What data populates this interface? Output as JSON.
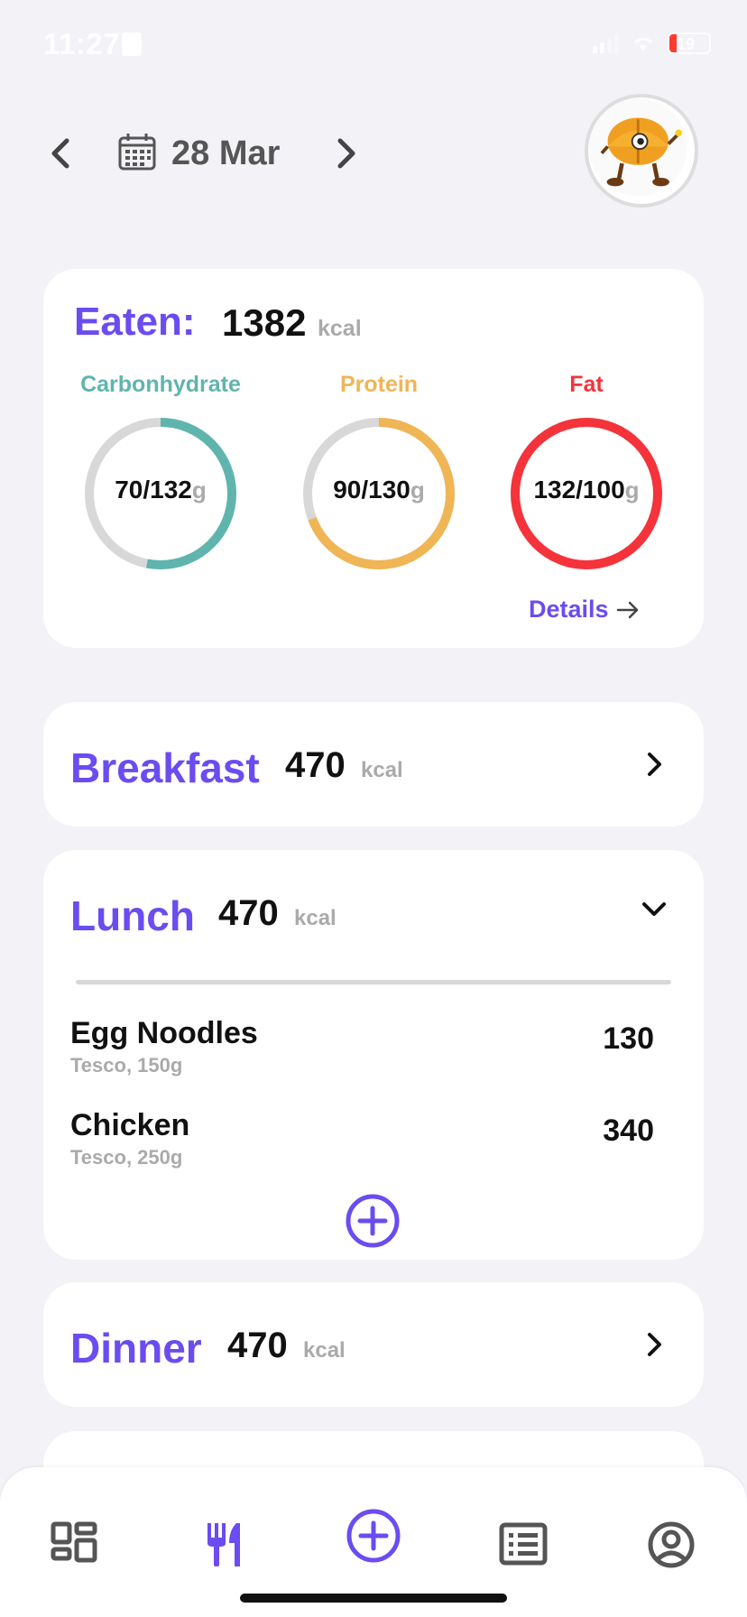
{
  "status_bar": {
    "time": "11:27",
    "battery_text": "19",
    "battery_level": 0.19
  },
  "header": {
    "date_label": "28 Mar"
  },
  "summary": {
    "eaten_label": "Eaten:",
    "eaten_value": "1382",
    "eaten_unit": "kcal",
    "macros": [
      {
        "name": "Carbonhydrate",
        "amount": "70/132",
        "unit": "g",
        "value": 70,
        "target": 132,
        "color": "#5fb5ad"
      },
      {
        "name": "Protein",
        "amount": "90/130",
        "unit": "g",
        "value": 90,
        "target": 130,
        "color": "#f0b554"
      },
      {
        "name": "Fat",
        "amount": "132/100",
        "unit": "g",
        "value": 132,
        "target": 100,
        "color": "#f5333a"
      }
    ],
    "details_label": "Details",
    "details_icon": "arrow-right-icon"
  },
  "meals": {
    "breakfast": {
      "title": "Breakfast",
      "kcal": "470",
      "unit": "kcal",
      "state_icon": "chevron-right-icon"
    },
    "lunch": {
      "title": "Lunch",
      "kcal": "470",
      "unit": "kcal",
      "state_icon": "chevron-down-icon",
      "items": [
        {
          "name": "Egg Noodles",
          "sub": "Tesco, 150g",
          "cal": "130"
        },
        {
          "name": "Chicken",
          "sub": "Tesco, 250g",
          "cal": "340"
        }
      ]
    },
    "dinner": {
      "title": "Dinner",
      "kcal": "470",
      "unit": "kcal",
      "state_icon": "chevron-right-icon"
    }
  },
  "tab_bar": {
    "tabs": [
      "dashboard-icon",
      "food-icon",
      "add-icon",
      "list-icon",
      "profile-icon"
    ],
    "active_tab": "food-icon"
  },
  "colors": {
    "accent": "#6a4cf0",
    "background": "#f2f2f7",
    "muted": "#aaaaaa"
  }
}
